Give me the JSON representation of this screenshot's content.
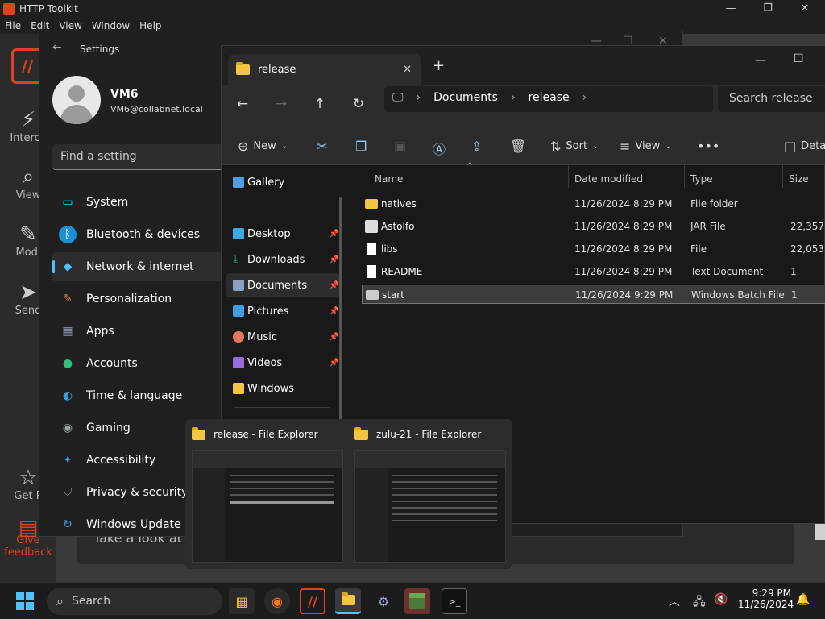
{
  "htk": {
    "title": "HTTP Toolkit",
    "menu": [
      "File",
      "Edit",
      "View",
      "Window",
      "Help"
    ],
    "sidebar": [
      {
        "label": "Interce",
        "icon": "plug-icon"
      },
      {
        "label": "View",
        "icon": "search-icon"
      },
      {
        "label": "Modi",
        "icon": "pencil-icon"
      },
      {
        "label": "Send",
        "icon": "send-icon"
      },
      {
        "label": "Get P",
        "icon": "star-icon"
      },
      {
        "label": "Give feedback",
        "icon": "feedback-icon"
      }
    ],
    "card_text": "Take a look at th",
    "accent": "#e1421f"
  },
  "settings": {
    "title": "Settings",
    "user": {
      "name": "VM6",
      "email": "VM6@collabnet.local"
    },
    "search_placeholder": "Find a setting",
    "nav": [
      {
        "label": "System",
        "icon": "monitor-icon",
        "color": "#4cc2ff",
        "glyph": "▭"
      },
      {
        "label": "Bluetooth & devices",
        "icon": "bluetooth-icon",
        "color": "#1f8fd6",
        "glyph": "ᛒ"
      },
      {
        "label": "Network & internet",
        "icon": "wifi-icon",
        "color": "#4cc2ff",
        "glyph": "◆",
        "active": true
      },
      {
        "label": "Personalization",
        "icon": "brush-icon",
        "color": "#d08b40",
        "glyph": "✎"
      },
      {
        "label": "Apps",
        "icon": "apps-icon",
        "color": "#8a9bb0",
        "glyph": "▦"
      },
      {
        "label": "Accounts",
        "icon": "person-icon",
        "color": "#30c27a",
        "glyph": "●"
      },
      {
        "label": "Time & language",
        "icon": "globe-icon",
        "color": "#3b9ee0",
        "glyph": "◐"
      },
      {
        "label": "Gaming",
        "icon": "gamepad-icon",
        "color": "#9aa0a6",
        "glyph": "◉"
      },
      {
        "label": "Accessibility",
        "icon": "accessibility-icon",
        "color": "#3b9ee0",
        "glyph": "✦"
      },
      {
        "label": "Privacy & security",
        "icon": "shield-icon",
        "color": "#8a8f96",
        "glyph": "⛉"
      },
      {
        "label": "Windows Update",
        "icon": "update-icon",
        "color": "#3b9ee0",
        "glyph": "↻"
      }
    ]
  },
  "explorer": {
    "tab_title": "release",
    "breadcrumbs": [
      "Documents",
      "release"
    ],
    "search_placeholder": "Search release",
    "toolbar": {
      "new": "New",
      "sort": "Sort",
      "view": "View",
      "details": "Details"
    },
    "nav": [
      {
        "label": "Gallery",
        "icon": "gallery-icon",
        "color": "#4a9fe8",
        "pinned": false
      },
      {
        "label": "Desktop",
        "icon": "desktop-icon",
        "color": "#3fa8e0",
        "pinned": true
      },
      {
        "label": "Downloads",
        "icon": "download-icon",
        "color": "#30b070",
        "pinned": true
      },
      {
        "label": "Documents",
        "icon": "document-icon",
        "color": "#8aa0c0",
        "pinned": true,
        "selected": true
      },
      {
        "label": "Pictures",
        "icon": "pictures-icon",
        "color": "#3f9fe0",
        "pinned": true
      },
      {
        "label": "Music",
        "icon": "music-icon",
        "color": "#e07a5a",
        "pinned": true
      },
      {
        "label": "Videos",
        "icon": "videos-icon",
        "color": "#9a6ae0",
        "pinned": true
      },
      {
        "label": "Windows",
        "icon": "folder-icon",
        "color": "#f4c542",
        "pinned": false
      }
    ],
    "columns": [
      "Name",
      "Date modified",
      "Type",
      "Size"
    ],
    "files": [
      {
        "name": "natives",
        "date": "11/26/2024 8:29 PM",
        "type": "File folder",
        "size": "",
        "icon": "folder-icon"
      },
      {
        "name": "Astolfo",
        "date": "11/26/2024 8:29 PM",
        "type": "JAR File",
        "size": "22,357",
        "icon": "jar-icon"
      },
      {
        "name": "libs",
        "date": "11/26/2024 8:29 PM",
        "type": "File",
        "size": "22,053",
        "icon": "file-icon"
      },
      {
        "name": "README",
        "date": "11/26/2024 8:29 PM",
        "type": "Text Document",
        "size": "1",
        "icon": "text-file-icon"
      },
      {
        "name": "start",
        "date": "11/26/2024 9:29 PM",
        "type": "Windows Batch File",
        "size": "1",
        "icon": "batch-file-icon",
        "selected": true
      }
    ]
  },
  "thumbnails": [
    {
      "title": "release - File Explorer"
    },
    {
      "title": "zulu-21 - File Explorer"
    }
  ],
  "taskbar": {
    "search": "Search",
    "time": "9:29 PM",
    "date": "11/26/2024"
  }
}
